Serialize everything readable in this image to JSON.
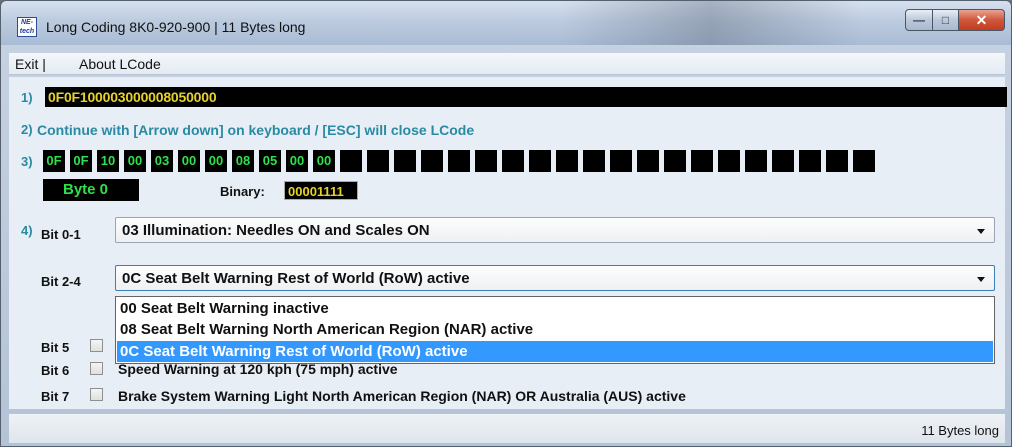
{
  "window": {
    "app_icon_text": "NE-tech",
    "title": "Long Coding  8K0-920-900 | 11 Bytes long"
  },
  "menu": {
    "items": [
      "Exit |",
      "About LCode"
    ]
  },
  "rows": {
    "r1": "1)",
    "r2": "2)",
    "r3": "3)",
    "r4": "4)",
    "code_value": "0F0F100003000008050000",
    "hint": "Continue with [Arrow down] on keyboard / [ESC] will close LCode"
  },
  "bytes": [
    "0F",
    "0F",
    "10",
    "00",
    "03",
    "00",
    "00",
    "08",
    "05",
    "00",
    "00",
    "",
    "",
    "",
    "",
    "",
    "",
    "",
    "",
    "",
    "",
    "",
    "",
    "",
    "",
    "",
    "",
    "",
    "",
    "",
    ""
  ],
  "byte_info": {
    "label": "Byte 0",
    "binary_label": "Binary:",
    "binary_value": "00001111"
  },
  "bits": {
    "bit01": {
      "label": "Bit 0-1",
      "value": "03 Illumination: Needles ON and Scales ON"
    },
    "bit24": {
      "label": "Bit 2-4",
      "value": "0C Seat Belt Warning Rest of World (RoW) active",
      "options": [
        "00 Seat Belt Warning inactive",
        "08 Seat Belt Warning North American Region (NAR) active",
        "0C Seat Belt Warning Rest of World (RoW) active"
      ],
      "selected_index": 2
    },
    "bit5": {
      "label": "Bit 5",
      "text": ""
    },
    "bit6": {
      "label": "Bit 6",
      "text": "Speed Warning at 120 kph (75 mph) active"
    },
    "bit7": {
      "label": "Bit 7",
      "text": "Brake System Warning Light North American Region (NAR) OR Australia (AUS) active"
    }
  },
  "status": {
    "text": "11 Bytes long"
  },
  "colors": {
    "accent": "#2a8aa3",
    "code_yellow": "#e6d22a",
    "byte_green": "#2ee04b",
    "selection": "#3399ff"
  }
}
